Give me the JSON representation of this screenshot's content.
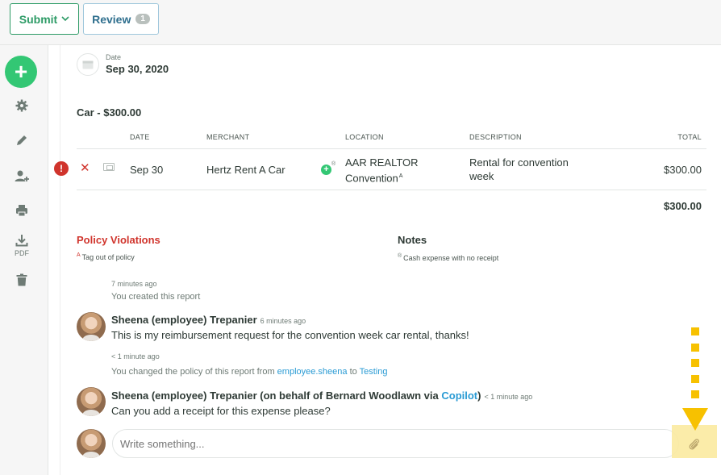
{
  "toolbar": {
    "submit_label": "Submit",
    "review_label": "Review",
    "review_count": "1"
  },
  "sidebar": {
    "add_icon": "plus-icon",
    "items": [
      {
        "name": "settings",
        "icon": "gear-icon"
      },
      {
        "name": "edit",
        "icon": "pencil-icon"
      },
      {
        "name": "add-user",
        "icon": "person-add-icon"
      },
      {
        "name": "print",
        "icon": "printer-icon"
      },
      {
        "name": "download-pdf",
        "icon": "download-icon",
        "label": "PDF"
      },
      {
        "name": "delete",
        "icon": "trash-icon"
      }
    ]
  },
  "report": {
    "date_label": "Date",
    "date_value": "Sep 30, 2020",
    "section_title": "Car - $300.00",
    "columns": [
      "DATE",
      "MERCHANT",
      "LOCATION",
      "DESCRIPTION",
      "TOTAL"
    ],
    "rows": [
      {
        "date": "Sep 30",
        "merchant": "Hertz Rent A Car",
        "merchant_marker": "®",
        "location_line1": "AAR REALTOR",
        "location_line2": "Convention",
        "location_marker": "A",
        "description_line1": "Rental for convention",
        "description_line2": "week",
        "total": "$300.00"
      }
    ],
    "grand_total": "$300.00"
  },
  "policy": {
    "title": "Policy Violations",
    "note_marker": "A",
    "note": "Tag out of policy"
  },
  "notes": {
    "title": "Notes",
    "note_marker": "®",
    "note": "Cash expense with no receipt"
  },
  "activity": {
    "entry1": {
      "time": "7 minutes ago",
      "text": "You created this report"
    },
    "entry2": {
      "author": "Sheena (employee) Trepanier",
      "time": "6 minutes ago",
      "message": "This is my reimbursement request for the convention week car rental, thanks!"
    },
    "entry3": {
      "time": "< 1 minute ago",
      "text_before": "You changed the policy of this report from",
      "from_policy": "employee.sheena",
      "text_middle": "to",
      "to_policy": "Testing"
    },
    "entry4": {
      "author": "Sheena (employee) Trepanier (on behalf of Bernard Woodlawn via",
      "via": "Copilot",
      "author_close": ")",
      "time": "< 1 minute ago",
      "message": "Can you add a receipt for this expense please?"
    }
  },
  "compose": {
    "placeholder": "Write something..."
  },
  "colors": {
    "accent_green": "#33c774",
    "error_red": "#d0342c",
    "link_blue": "#2a9bd4",
    "highlight_yellow": "#f7c100"
  }
}
